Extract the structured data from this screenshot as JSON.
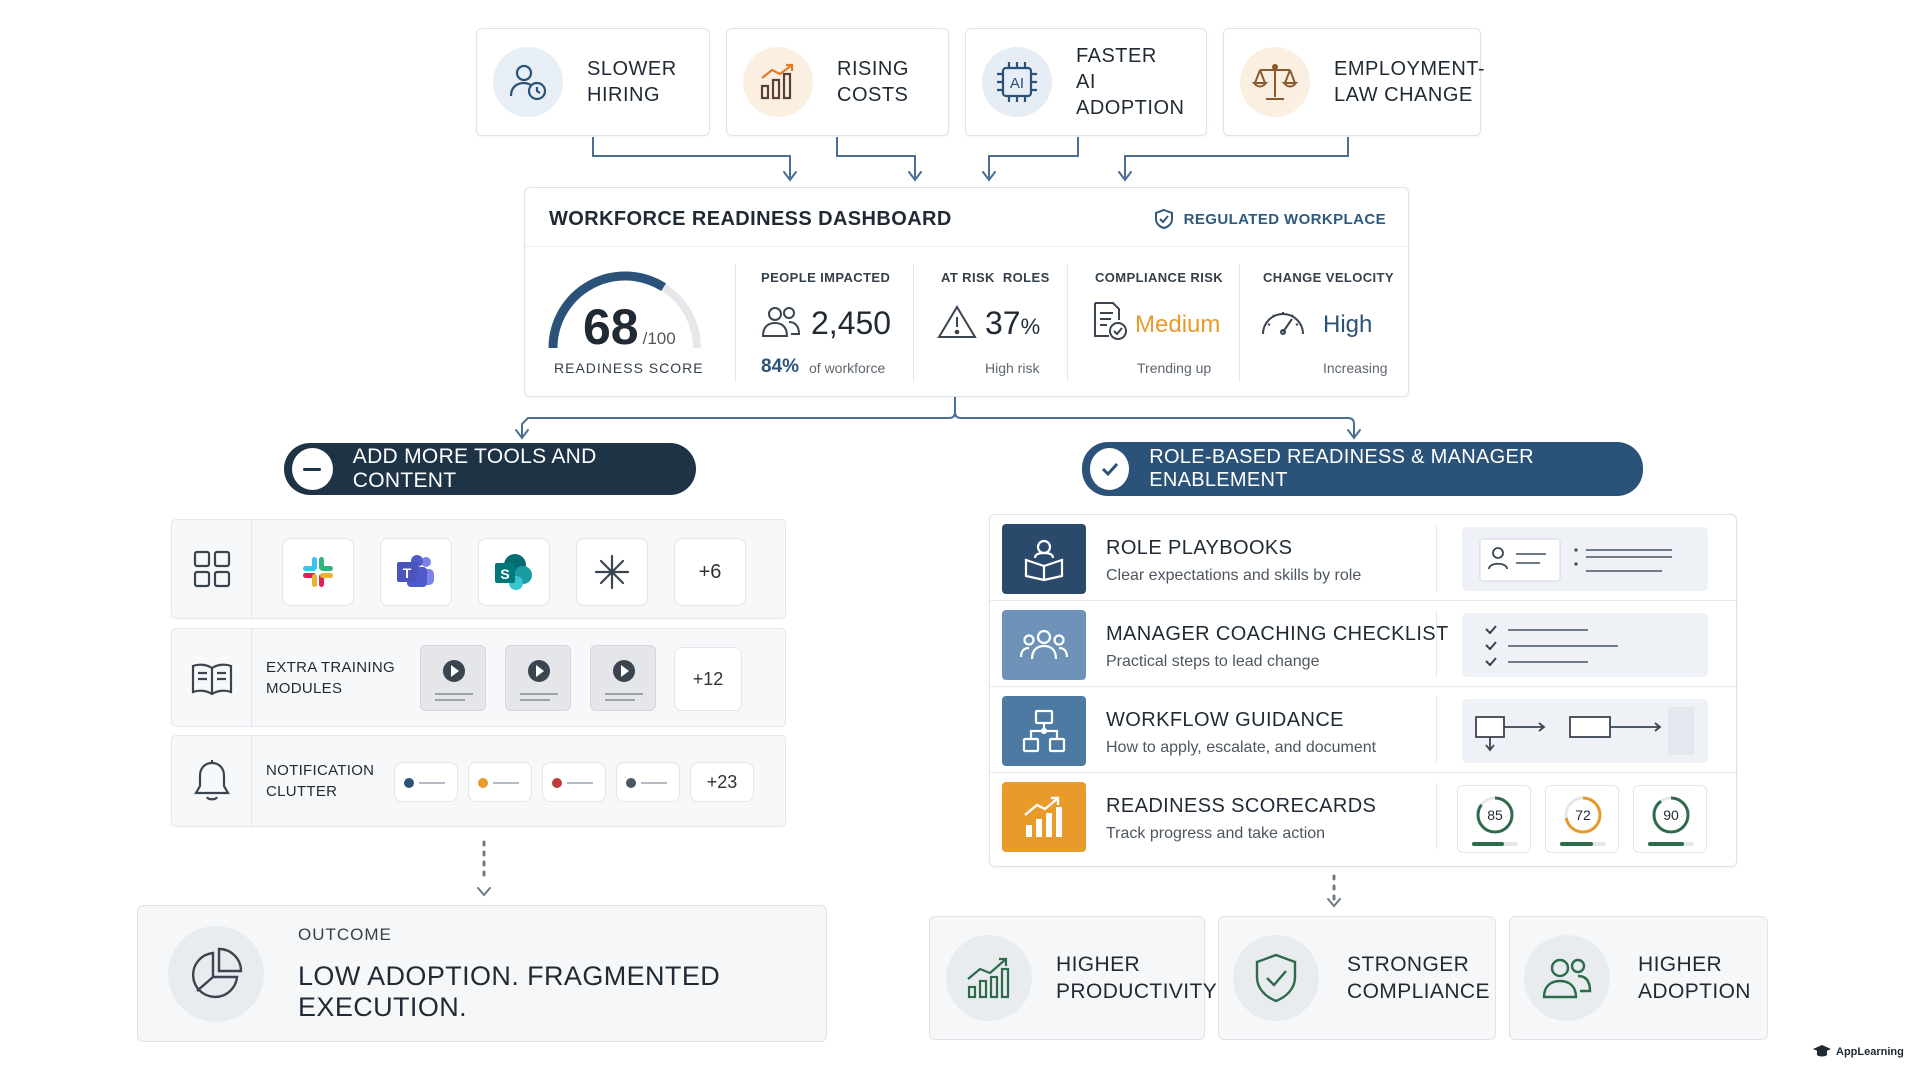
{
  "drivers": [
    {
      "label": "SLOWER\nHIRING",
      "icon": "user-clock-icon"
    },
    {
      "label": "RISING\nCOSTS",
      "icon": "bar-chart-up-icon"
    },
    {
      "label": "FASTER\nAI ADOPTION",
      "icon": "ai-chip-icon",
      "chip_text": "AI"
    },
    {
      "label": "EMPLOYMENT-\nLAW CHANGE",
      "icon": "scales-icon"
    }
  ],
  "dashboard": {
    "title": "WORKFORCE READINESS DASHBOARD",
    "badge": "REGULATED WORKPLACE",
    "score": {
      "value": "68",
      "max": "/100",
      "label": "READINESS SCORE",
      "fraction": 0.68
    },
    "metrics": {
      "people": {
        "head": "PEOPLE IMPACTED",
        "value": "2,450",
        "pct": "84%",
        "sub": "of workforce"
      },
      "risk": {
        "head": "AT RISK  ROLES",
        "value": "37",
        "unit": "%",
        "sub": "High risk"
      },
      "compliance": {
        "head": "COMPLIANCE RISK",
        "value": "Medium",
        "sub": "Trending up"
      },
      "velocity": {
        "head": "CHANGE VELOCITY",
        "value": "High",
        "sub": "Increasing"
      }
    }
  },
  "left_branch": {
    "pill": "ADD MORE TOOLS AND CONTENT",
    "tools_more": "+6",
    "training": {
      "label": "EXTRA TRAINING\nMODULES",
      "more": "+12"
    },
    "notifications": {
      "label": "NOTIFICATION\nCLUTTER",
      "more": "+23"
    },
    "outcome": {
      "head": "OUTCOME",
      "text": "LOW ADOPTION. FRAGMENTED EXECUTION."
    }
  },
  "right_branch": {
    "pill": "ROLE-BASED READINESS & MANAGER ENABLEMENT",
    "items": [
      {
        "title": "ROLE PLAYBOOKS",
        "sub": "Clear expectations and skills by role"
      },
      {
        "title": "MANAGER COACHING CHECKLIST",
        "sub": "Practical steps to lead change"
      },
      {
        "title": "WORKFLOW GUIDANCE",
        "sub": "How to apply, escalate, and document"
      },
      {
        "title": "READINESS SCORECARDS",
        "sub": "Track progress and take action"
      }
    ],
    "scores": [
      "85",
      "72",
      "90"
    ],
    "outcomes": [
      {
        "label": "HIGHER\nPRODUCTIVITY"
      },
      {
        "label": "STRONGER\nCOMPLIANCE"
      },
      {
        "label": "HIGHER\nADOPTION"
      }
    ]
  },
  "brand": "AppLearning",
  "colors": {
    "navy": "#2b5278",
    "blue_mid": "#6f93b8",
    "slate": "#4d7aa3",
    "orange": "#e89a2a",
    "green": "#2e6b4a",
    "red": "#c03a3a"
  }
}
